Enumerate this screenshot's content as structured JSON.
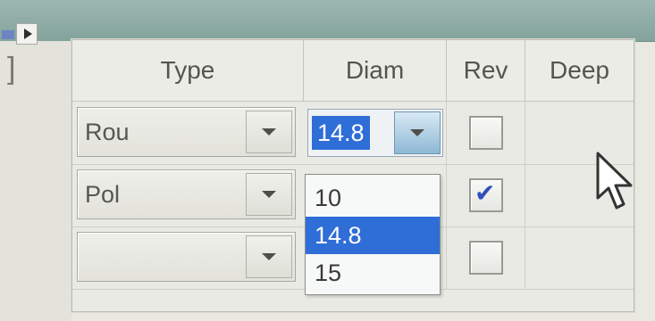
{
  "table": {
    "headers": {
      "type": "Type",
      "diam": "Diam",
      "rev": "Rev",
      "deep": "Deep"
    },
    "rows": [
      {
        "type": "Rou",
        "diam": "14.8",
        "rev_checked": false
      },
      {
        "type": "Pol",
        "diam": "",
        "rev_checked": true
      },
      {
        "type": "",
        "diam": "",
        "rev_checked": false
      }
    ]
  },
  "diameter_dropdown": {
    "options": [
      "10",
      "14.8",
      "15"
    ],
    "selected": "14.8"
  },
  "icons": {
    "toolbar_arrow": "triangle-right-icon",
    "dropdown_arrow": "chevron-down-icon",
    "checkbox_mark": "check-icon",
    "cursor": "mouse-cursor-icon"
  },
  "colors": {
    "selection": "#2f6dd7",
    "header_text": "#555550",
    "check": "#2f4fba"
  }
}
